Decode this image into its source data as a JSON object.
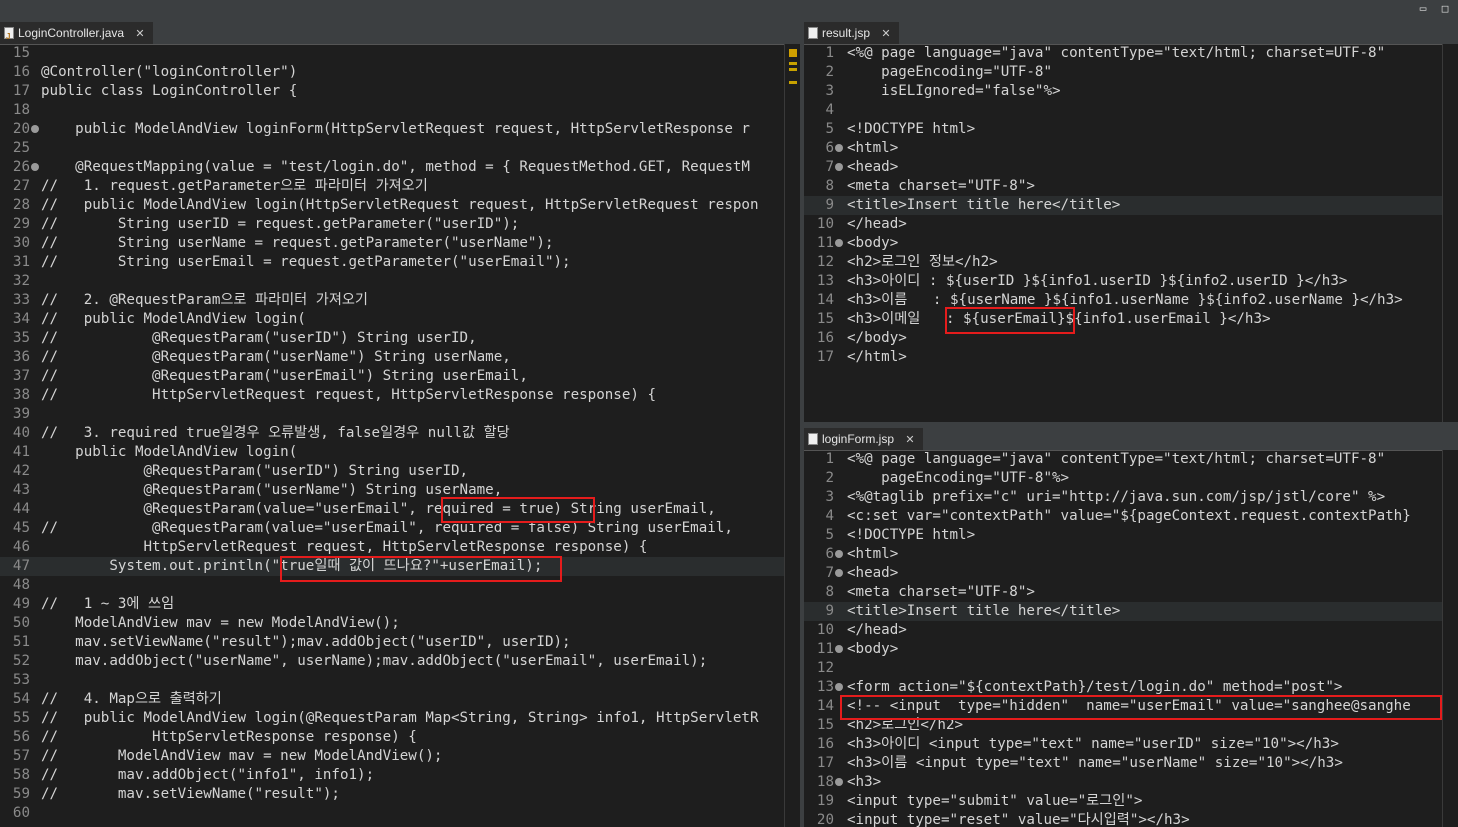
{
  "window": {
    "min_label": "▭",
    "max_label": "□"
  },
  "left": {
    "tab": "LoginController.java",
    "lines": [
      {
        "n": "15",
        "t": ""
      },
      {
        "n": "16",
        "t": "@Controller(\"loginController\")"
      },
      {
        "n": "17",
        "t": "public class LoginController {"
      },
      {
        "n": "18",
        "t": ""
      },
      {
        "n": "20",
        "t": "    public ModelAndView loginForm(HttpServletRequest request, HttpServletResponse r",
        "fold": "+"
      },
      {
        "n": "25",
        "t": ""
      },
      {
        "n": "26",
        "t": "    @RequestMapping(value = \"test/login.do\", method = { RequestMethod.GET, RequestM",
        "fold": "-"
      },
      {
        "n": "27",
        "t": "//   1. request.getParameter으로 파라미터 가져오기"
      },
      {
        "n": "28",
        "t": "//   public ModelAndView login(HttpServletRequest request, HttpServletRequest respon"
      },
      {
        "n": "29",
        "t": "//       String userID = request.getParameter(\"userID\");"
      },
      {
        "n": "30",
        "t": "//       String userName = request.getParameter(\"userName\");"
      },
      {
        "n": "31",
        "t": "//       String userEmail = request.getParameter(\"userEmail\");"
      },
      {
        "n": "32",
        "t": ""
      },
      {
        "n": "33",
        "t": "//   2. @RequestParam으로 파라미터 가져오기"
      },
      {
        "n": "34",
        "t": "//   public ModelAndView login("
      },
      {
        "n": "35",
        "t": "//           @RequestParam(\"userID\") String userID,"
      },
      {
        "n": "36",
        "t": "//           @RequestParam(\"userName\") String userName,"
      },
      {
        "n": "37",
        "t": "//           @RequestParam(\"userEmail\") String userEmail,"
      },
      {
        "n": "38",
        "t": "//           HttpServletRequest request, HttpServletResponse response) {"
      },
      {
        "n": "39",
        "t": ""
      },
      {
        "n": "40",
        "t": "//   3. required true일경우 오류발생, false일경우 null값 할당"
      },
      {
        "n": "41",
        "t": "    public ModelAndView login("
      },
      {
        "n": "42",
        "t": "            @RequestParam(\"userID\") String userID,"
      },
      {
        "n": "43",
        "t": "            @RequestParam(\"userName\") String userName,"
      },
      {
        "n": "44",
        "t": "            @RequestParam(value=\"userEmail\", required = true) String userEmail,"
      },
      {
        "n": "45",
        "t": "//           @RequestParam(value=\"userEmail\", required = false) String userEmail,"
      },
      {
        "n": "46",
        "t": "            HttpServletRequest request, HttpServletResponse response) {"
      },
      {
        "n": "47",
        "t": "        System.out.println(\"true일때 값이 뜨나요?\"+userEmail);",
        "hl": true
      },
      {
        "n": "48",
        "t": ""
      },
      {
        "n": "49",
        "t": "//   1 ~ 3에 쓰임"
      },
      {
        "n": "50",
        "t": "    ModelAndView mav = new ModelAndView();"
      },
      {
        "n": "51",
        "t": "    mav.setViewName(\"result\");mav.addObject(\"userID\", userID);"
      },
      {
        "n": "52",
        "t": "    mav.addObject(\"userName\", userName);mav.addObject(\"userEmail\", userEmail);"
      },
      {
        "n": "53",
        "t": ""
      },
      {
        "n": "54",
        "t": "//   4. Map으로 출력하기"
      },
      {
        "n": "55",
        "t": "//   public ModelAndView login(@RequestParam Map<String, String> info1, HttpServletR"
      },
      {
        "n": "56",
        "t": "//           HttpServletResponse response) {"
      },
      {
        "n": "57",
        "t": "//       ModelAndView mav = new ModelAndView();"
      },
      {
        "n": "58",
        "t": "//       mav.addObject(\"info1\", info1);"
      },
      {
        "n": "59",
        "t": "//       mav.setViewName(\"result\");"
      },
      {
        "n": "60",
        "t": ""
      }
    ]
  },
  "result": {
    "tab": "result.jsp",
    "lines": [
      {
        "n": "1",
        "t": "<%@ page language=\"java\" contentType=\"text/html; charset=UTF-8\""
      },
      {
        "n": "2",
        "t": "    pageEncoding=\"UTF-8\""
      },
      {
        "n": "3",
        "t": "    isELIgnored=\"false\"%>"
      },
      {
        "n": "4",
        "t": ""
      },
      {
        "n": "5",
        "t": "<!DOCTYPE html>"
      },
      {
        "n": "6",
        "t": "<html>",
        "fold": "-"
      },
      {
        "n": "7",
        "t": "<head>",
        "fold": "-"
      },
      {
        "n": "8",
        "t": "<meta charset=\"UTF-8\">"
      },
      {
        "n": "9",
        "t": "<title>Insert title here</title>",
        "hl": true
      },
      {
        "n": "10",
        "t": "</head>"
      },
      {
        "n": "11",
        "t": "<body>",
        "fold": "-"
      },
      {
        "n": "12",
        "t": "<h2>로그인 정보</h2>"
      },
      {
        "n": "13",
        "t": "<h3>아이디 : ${userID }${info1.userID }${info2.userID }</h3>"
      },
      {
        "n": "14",
        "t": "<h3>이름   : ${userName }${info1.userName }${info2.userName }</h3>"
      },
      {
        "n": "15",
        "t": "<h3>이메일   : ${userEmail}${info1.userEmail }</h3>"
      },
      {
        "n": "16",
        "t": "</body>"
      },
      {
        "n": "17",
        "t": "</html>"
      }
    ]
  },
  "loginform": {
    "tab": "loginForm.jsp",
    "lines": [
      {
        "n": "1",
        "t": "<%@ page language=\"java\" contentType=\"text/html; charset=UTF-8\""
      },
      {
        "n": "2",
        "t": "    pageEncoding=\"UTF-8\"%>"
      },
      {
        "n": "3",
        "t": "<%@taglib prefix=\"c\" uri=\"http://java.sun.com/jsp/jstl/core\" %>"
      },
      {
        "n": "4",
        "t": "<c:set var=\"contextPath\" value=\"${pageContext.request.contextPath}"
      },
      {
        "n": "5",
        "t": "<!DOCTYPE html>"
      },
      {
        "n": "6",
        "t": "<html>",
        "fold": "-"
      },
      {
        "n": "7",
        "t": "<head>",
        "fold": "-"
      },
      {
        "n": "8",
        "t": "<meta charset=\"UTF-8\">"
      },
      {
        "n": "9",
        "t": "<title>Insert title here</title>",
        "hl": true
      },
      {
        "n": "10",
        "t": "</head>"
      },
      {
        "n": "11",
        "t": "<body>",
        "fold": "-"
      },
      {
        "n": "12",
        "t": ""
      },
      {
        "n": "13",
        "t": "<form action=\"${contextPath}/test/login.do\" method=\"post\">",
        "fold": "-"
      },
      {
        "n": "14",
        "t": "<!-- <input  type=\"hidden\"  name=\"userEmail\" value=\"sanghee@sanghe"
      },
      {
        "n": "15",
        "t": "<h2>로그인</h2>"
      },
      {
        "n": "16",
        "t": "<h3>아이디 <input type=\"text\" name=\"userID\" size=\"10\"></h3>"
      },
      {
        "n": "17",
        "t": "<h3>이름 <input type=\"text\" name=\"userName\" size=\"10\"></h3>"
      },
      {
        "n": "18",
        "t": "<h3>",
        "fold": "-"
      },
      {
        "n": "19",
        "t": "<input type=\"submit\" value=\"로그인\">"
      },
      {
        "n": "20",
        "t": "<input type=\"reset\" value=\"다시입력\"></h3>"
      }
    ]
  },
  "colors": {
    "highlight_box": "#e51c1c",
    "editor_bg": "#1e1e1e"
  }
}
